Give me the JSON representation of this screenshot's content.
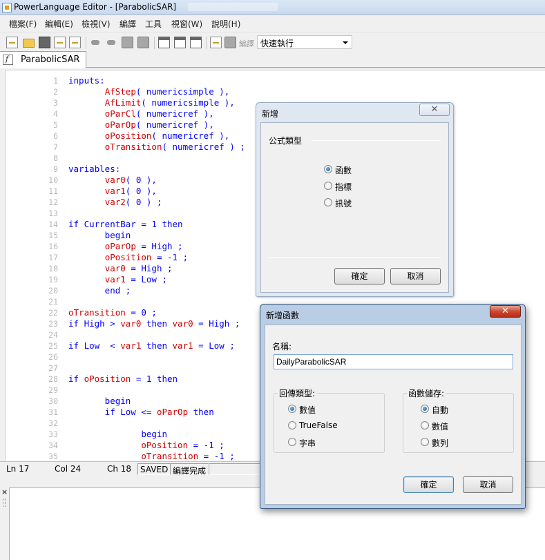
{
  "window": {
    "title": "PowerLanguage Editor - [ParabolicSAR]"
  },
  "menu": [
    "檔案(F)",
    "編輯(E)",
    "檢視(V)",
    "編譯",
    "工具",
    "視窗(W)",
    "說明(H)"
  ],
  "toolbar": {
    "compile_label": "編譯",
    "run_mode_value": "快速執行"
  },
  "tab": {
    "label": "ParabolicSAR"
  },
  "code": [
    {
      "n": "1",
      "t": "inputs:"
    },
    {
      "n": "2",
      "t": "       AfStep( numericsimple ),"
    },
    {
      "n": "3",
      "t": "       AfLimit( numericsimple ),"
    },
    {
      "n": "4",
      "t": "       oParCl( numericref ),"
    },
    {
      "n": "5",
      "t": "       oParOp( numericref ),"
    },
    {
      "n": "6",
      "t": "       oPosition( numericref ),"
    },
    {
      "n": "7",
      "t": "       oTransition( numericref ) ;"
    },
    {
      "n": "8",
      "t": ""
    },
    {
      "n": "9",
      "t": "variables:"
    },
    {
      "n": "10",
      "t": "       var0( 0 ),"
    },
    {
      "n": "11",
      "t": "       var1( 0 ),"
    },
    {
      "n": "12",
      "t": "       var2( 0 ) ;"
    },
    {
      "n": "13",
      "t": ""
    },
    {
      "n": "14",
      "t": "if CurrentBar = 1 then"
    },
    {
      "n": "15",
      "t": "       begin"
    },
    {
      "n": "16",
      "t": "       oParOp = High ;"
    },
    {
      "n": "17",
      "t": "       oPosition = -1 ;"
    },
    {
      "n": "18",
      "t": "       var0 = High ;"
    },
    {
      "n": "19",
      "t": "       var1 = Low ;"
    },
    {
      "n": "20",
      "t": "       end ;"
    },
    {
      "n": "21",
      "t": ""
    },
    {
      "n": "22",
      "t": "oTransition = 0 ;"
    },
    {
      "n": "23",
      "t": "if High > var0 then var0 = High ;"
    },
    {
      "n": "24",
      "t": ""
    },
    {
      "n": "25",
      "t": "if Low  < var1 then var1 = Low ;"
    },
    {
      "n": "26",
      "t": ""
    },
    {
      "n": "27",
      "t": ""
    },
    {
      "n": "28",
      "t": "if oPosition = 1 then"
    },
    {
      "n": "29",
      "t": ""
    },
    {
      "n": "30",
      "t": "       begin"
    },
    {
      "n": "31",
      "t": "       if Low <= oParOp then"
    },
    {
      "n": "32",
      "t": ""
    },
    {
      "n": "33",
      "t": "              begin"
    },
    {
      "n": "34",
      "t": "              oPosition = -1 ;"
    },
    {
      "n": "35",
      "t": "              oTransition = -1 ;"
    }
  ],
  "status": {
    "line": "Ln 17",
    "col": "Col 24",
    "ch": "Ch 18",
    "saved": "SAVED",
    "compile": "編譯完成"
  },
  "output_close": "×",
  "dialog_new": {
    "title": "新增",
    "group_label": "公式類型",
    "options": [
      "函數",
      "指標",
      "訊號"
    ],
    "selected_index": 0,
    "ok": "確定",
    "cancel": "取消"
  },
  "dialog_function": {
    "title": "新增函數",
    "name_label": "名稱:",
    "name_value": "DailyParabolicSAR",
    "return_group": "回傳類型:",
    "return_options": [
      "數值",
      "TrueFalse",
      "字串"
    ],
    "return_selected": 0,
    "storage_group": "函數儲存:",
    "storage_options": [
      "自動",
      "數值",
      "數列"
    ],
    "storage_selected": 0,
    "ok": "確定",
    "cancel": "取消"
  },
  "close_glyph": "✕"
}
